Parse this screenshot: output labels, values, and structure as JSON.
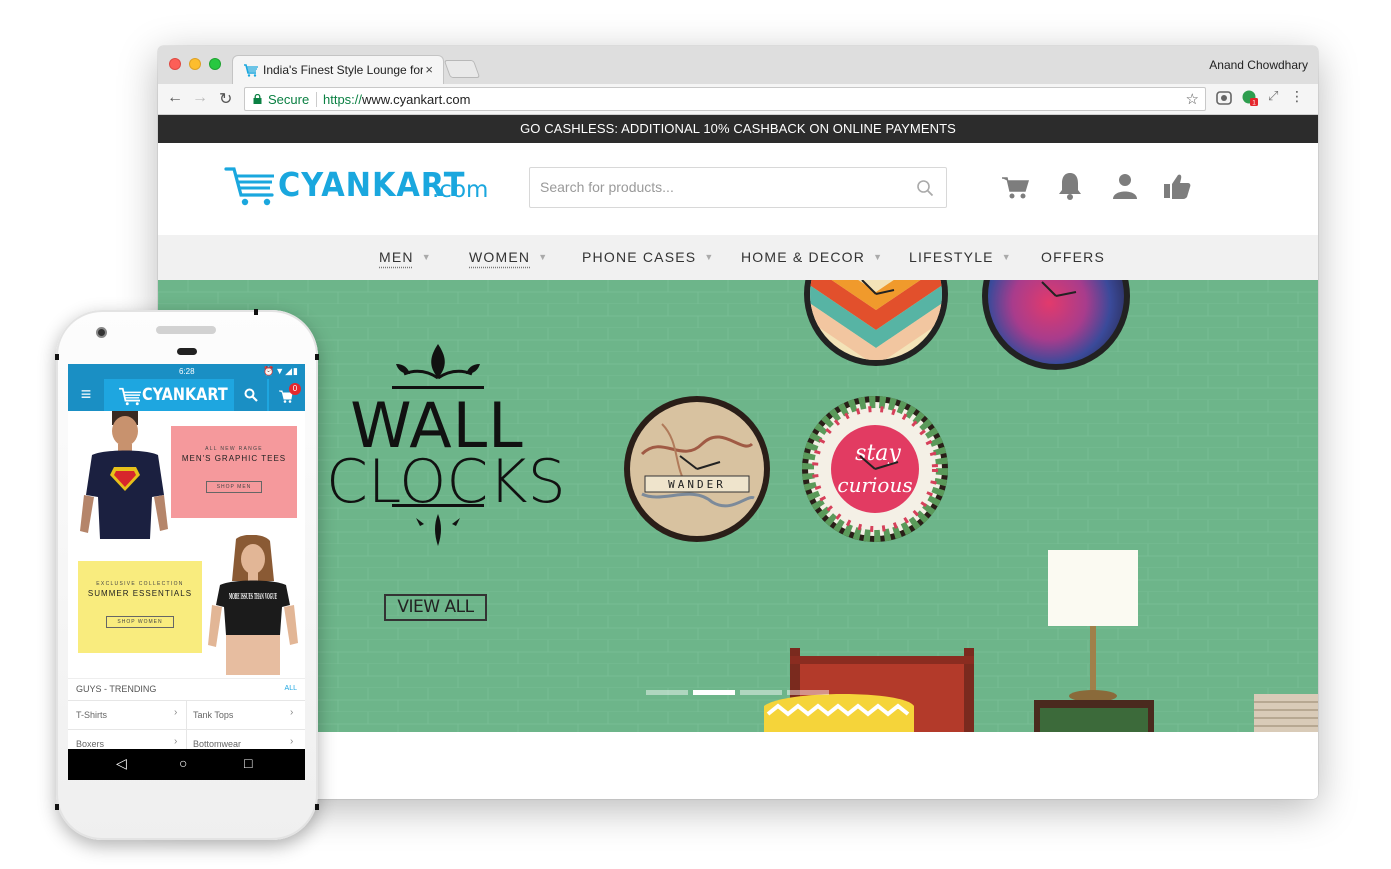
{
  "browser": {
    "tab_title": "India's Finest Style Lounge for",
    "tab_close": "×",
    "profile_name": "Anand Chowdhary",
    "secure_label": "Secure",
    "url_scheme": "https://",
    "url_host": "www.cyankart.com"
  },
  "site": {
    "promo_text": "GO CASHLESS: ADDITIONAL 10% CASHBACK ON ONLINE PAYMENTS",
    "logo_word": "CYANKART",
    "logo_suffix": ".com",
    "search_placeholder": "Search for products...",
    "nav": [
      {
        "label": "MEN"
      },
      {
        "label": "WOMEN"
      },
      {
        "label": "PHONE CASES"
      },
      {
        "label": "HOME & DECOR"
      },
      {
        "label": "LIFESTYLE"
      },
      {
        "label": "OFFERS"
      }
    ],
    "hero": {
      "title_line1": "WALL",
      "title_line2": "CLOCKS",
      "cta": "VIEW ALL",
      "clock_word_wander": "WANDER",
      "clock_word_stay": "stay",
      "clock_word_curious": "curious",
      "slides_total": 4,
      "active_slide": 2
    }
  },
  "mobile": {
    "time": "6:28",
    "status_icons": "⏰▼◢▮",
    "logo_word": "CYANKART",
    "cart_count": "0",
    "banner1": {
      "kicker": "ALL NEW RANGE",
      "heading": "MEN'S GRAPHIC TEES",
      "button": "SHOP MEN"
    },
    "banner2": {
      "kicker": "EXCLUSIVE COLLECTION",
      "heading": "SUMMER ESSENTIALS",
      "button": "SHOP WOMEN"
    },
    "tee_print": "MORE ISSUES THAN VOGUE",
    "section_title": "GUYS - TRENDING",
    "section_all": "ALL",
    "rows": [
      [
        "T-Shirts",
        "Tank Tops"
      ],
      [
        "Boxers",
        "Bottomwear"
      ]
    ]
  },
  "colors": {
    "brand_cyan": "#1aa7de",
    "promo_bar": "#2c2c2c",
    "hero_green": "#6db58a",
    "banner_pink": "#f5999c",
    "banner_yellow": "#f9ec7e"
  }
}
